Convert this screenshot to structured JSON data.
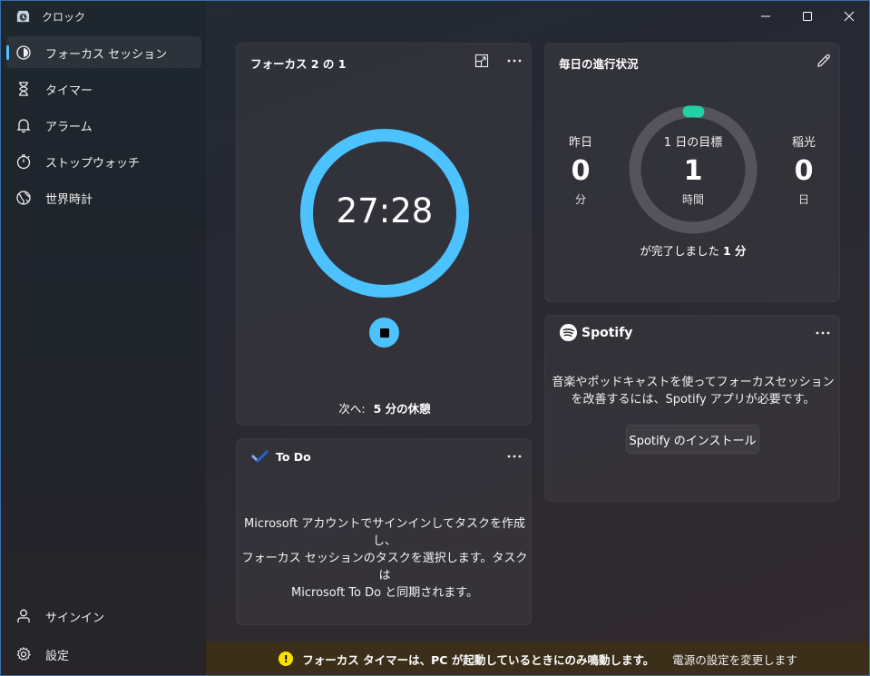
{
  "app": {
    "title": "クロック"
  },
  "sidebar": {
    "items": [
      {
        "label": "フォーカス セッション",
        "icon": "focus-icon",
        "active": true
      },
      {
        "label": "タイマー",
        "icon": "hourglass-icon"
      },
      {
        "label": "アラーム",
        "icon": "bell-icon"
      },
      {
        "label": "ストップウォッチ",
        "icon": "stopwatch-icon"
      },
      {
        "label": "世界時計",
        "icon": "globe-icon"
      }
    ],
    "bottom": [
      {
        "label": "サインイン",
        "icon": "person-icon"
      },
      {
        "label": "設定",
        "icon": "gear-icon"
      }
    ]
  },
  "focus": {
    "title": "フォーカス 2 の 1",
    "time": "27:28",
    "next_prefix": "次へ:",
    "next_value": "5 分の休憩",
    "ring_color": "#4cc2ff"
  },
  "progress": {
    "title": "毎日の進行状況",
    "yesterday_label": "昨日",
    "yesterday_value": "0",
    "yesterday_unit": "分",
    "goal_label": "1 日の目標",
    "goal_value": "1",
    "goal_unit": "時間",
    "streak_label": "稲光",
    "streak_value": "0",
    "streak_unit": "日",
    "completed_prefix": "が完了しました",
    "completed_value": "1 分",
    "accent": "#1fd1a3"
  },
  "todo": {
    "title": "To Do",
    "message_line1": "Microsoft アカウントでサインインしてタスクを作成し、",
    "message_line2": "フォーカス セッションのタスクを選択します。タスクは",
    "message_line3": "Microsoft To Do と同期されます。"
  },
  "spotify": {
    "brand": "Spotify",
    "message_line1": "音楽やポッドキャストを使ってフォーカスセッション",
    "message_line2": "を改善するには、Spotify アプリが必要です。",
    "install_label": "Spotify のインストール"
  },
  "infobar": {
    "message": "フォーカス タイマーは、PC が起動しているときにのみ鳴動します。",
    "link": "電源の設定を変更します"
  }
}
